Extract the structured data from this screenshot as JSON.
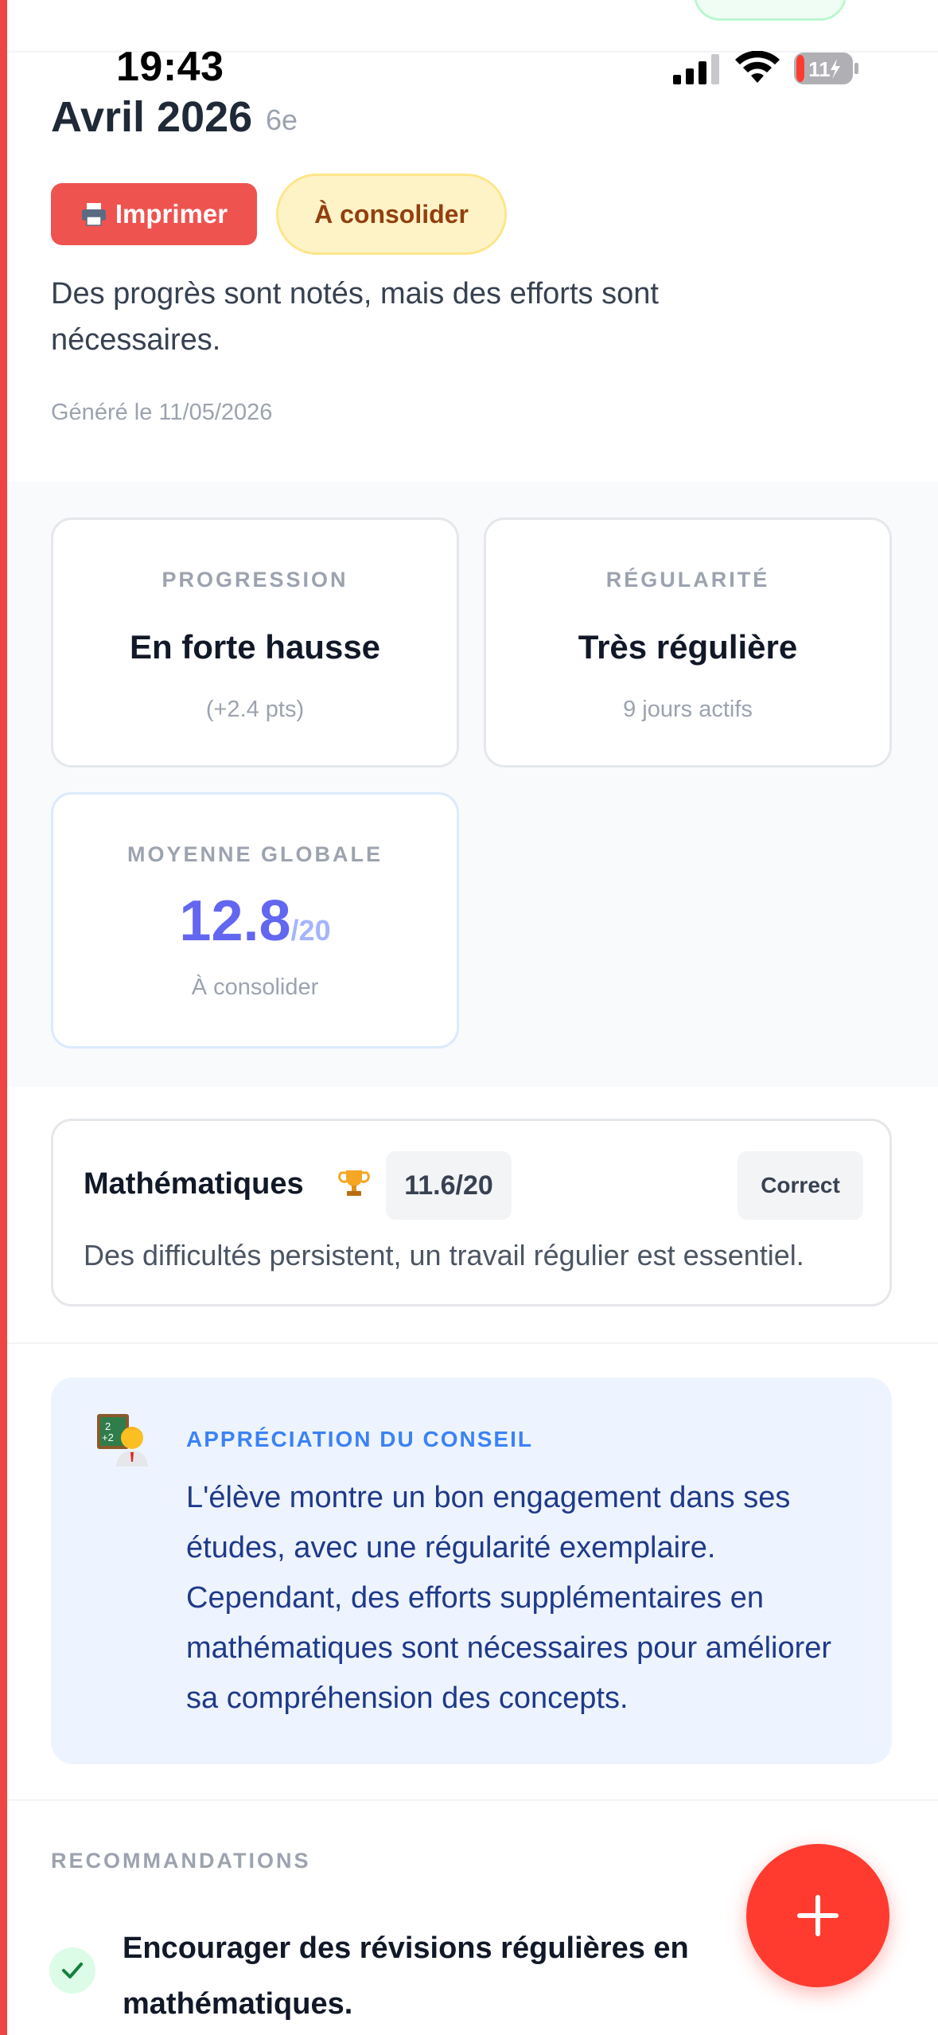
{
  "status_bar": {
    "time": "19:43",
    "battery": "11"
  },
  "header": {
    "title": "Avril 2026",
    "grade": "6e"
  },
  "actions": {
    "print_label": "Imprimer",
    "status_badge": "À consolider"
  },
  "summary": "Des progrès sont notés, mais des efforts sont nécessaires.",
  "generated": "Généré le 11/05/2026",
  "stats": {
    "progression": {
      "label": "PROGRESSION",
      "value": "En forte hausse",
      "sub": "(+2.4 pts)"
    },
    "regularite": {
      "label": "RÉGULARITÉ",
      "value": "Très régulière",
      "sub": "9 jours actifs"
    },
    "moyenne": {
      "label": "MOYENNE GLOBALE",
      "value": "12.8",
      "denominator": "/20",
      "sub": "À consolider"
    }
  },
  "subjects": [
    {
      "name": "Mathématiques",
      "icon": "trophy-icon",
      "score": "11.6/20",
      "level": "Correct",
      "comment": "Des difficultés persistent, un travail régulier est essentiel."
    }
  ],
  "council": {
    "title": "APPRÉCIATION DU CONSEIL",
    "icon": "teacher-icon",
    "text": "L'élève montre un bon engagement dans ses études, avec une régularité exemplaire. Cependant, des efforts supplémentaires en mathématiques sont nécessaires pour améliorer sa compréhension des concepts."
  },
  "recommendations": {
    "title": "RECOMMANDATIONS",
    "items": [
      "Encourager des révisions régulières en mathématiques."
    ]
  },
  "fab": {
    "icon": "plus-icon"
  },
  "colors": {
    "accent": "#6366f1",
    "danger": "#ef5350",
    "fab": "#ff3b30",
    "council_bg": "#eef4ff"
  }
}
